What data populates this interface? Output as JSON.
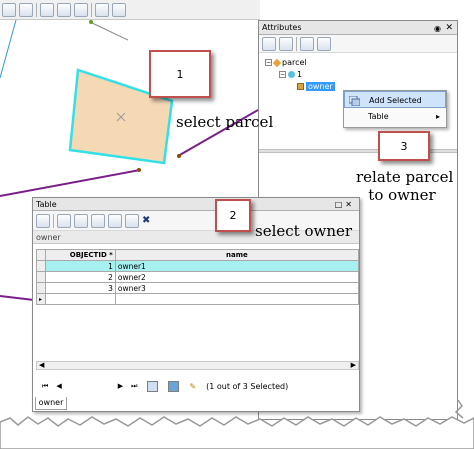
{
  "callouts": {
    "step1": {
      "number": "1",
      "caption": "select parcel"
    },
    "step2": {
      "number": "2",
      "caption": "select owner"
    },
    "step3": {
      "number": "3",
      "caption_line1": "relate parcel",
      "caption_line2": "to owner"
    }
  },
  "attributes": {
    "title": "Attributes",
    "tree": {
      "root": "parcel",
      "child": "1",
      "related": "owner"
    },
    "context_menu": {
      "items": [
        {
          "label": "Add Selected"
        },
        {
          "label": "Table"
        }
      ]
    }
  },
  "table": {
    "title": "Table",
    "tab_top": "owner",
    "columns": [
      "OBJECTID *",
      "name"
    ],
    "rows": [
      {
        "objectid": "1",
        "name": "owner1"
      },
      {
        "objectid": "2",
        "name": "owner2"
      },
      {
        "objectid": "3",
        "name": "owner3"
      }
    ],
    "status": "(1 out of 3 Selected)",
    "tab_bottom": "owner"
  },
  "colors": {
    "parcel_fill": "#f5d9b5",
    "parcel_outline": "#33e0e6",
    "line": "#7a1f8a",
    "callout_border": "#c0504d",
    "selection": "#3399ff",
    "row_selected": "#a6f0f0"
  },
  "icons": [
    "identify-icon",
    "find-binoculars-icon",
    "goto-xy-icon",
    "measure-icon",
    "html-popup-icon",
    "layer-icon",
    "close-icon",
    "pin-icon",
    "expand-icon",
    "add-selected-icon",
    "table-options-icon",
    "field-calculator-icon",
    "switch-selection-icon",
    "clear-selection-icon",
    "delete-icon",
    "first-record-icon",
    "prev-record-icon",
    "next-record-icon",
    "last-record-icon",
    "show-all-icon",
    "show-selected-icon"
  ]
}
